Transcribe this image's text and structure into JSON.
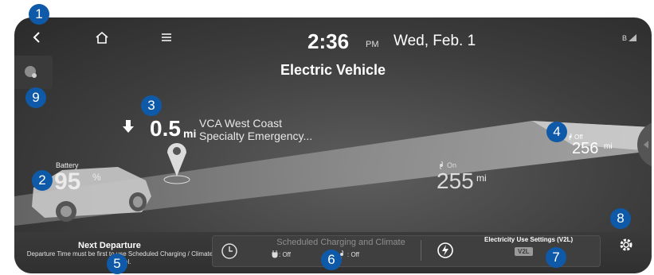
{
  "status": {
    "time": "2:36",
    "ampm": "PM",
    "date": "Wed, Feb. 1"
  },
  "title": "Electric Vehicle",
  "navigation": {
    "distance": "0.5",
    "unit": "mi",
    "destination_line1": "VCA West Coast",
    "destination_line2": "Specialty Emergency..."
  },
  "battery": {
    "label": "Battery",
    "value": "95",
    "unit": "%"
  },
  "range": {
    "on_label": "On",
    "on_value": "255",
    "off_label": "Off",
    "off_value": "256",
    "unit": "mi"
  },
  "next_departure": {
    "title": "Next Departure",
    "text": "Departure Time must be first to use Scheduled Charging / Climate Control."
  },
  "scheduled": {
    "title": "Scheduled Charging and Climate",
    "plug_status": ": Off",
    "fan_status": ": Off"
  },
  "v2l": {
    "title": "Electricity Use Settings (V2L)",
    "badge": "V2L"
  },
  "markers": [
    "1",
    "2",
    "3",
    "4",
    "5",
    "6",
    "7",
    "8",
    "9"
  ],
  "icons": {
    "back": "back-icon",
    "home": "home-icon",
    "menu": "menu-icon",
    "signal": "signal-icon",
    "settings": "gear-icon",
    "clock": "clock-icon",
    "v2l": "v2l-icon",
    "station": "charging-station-icon"
  },
  "colors": {
    "marker": "#0e5aa8",
    "screen": "#3e3e3e"
  }
}
